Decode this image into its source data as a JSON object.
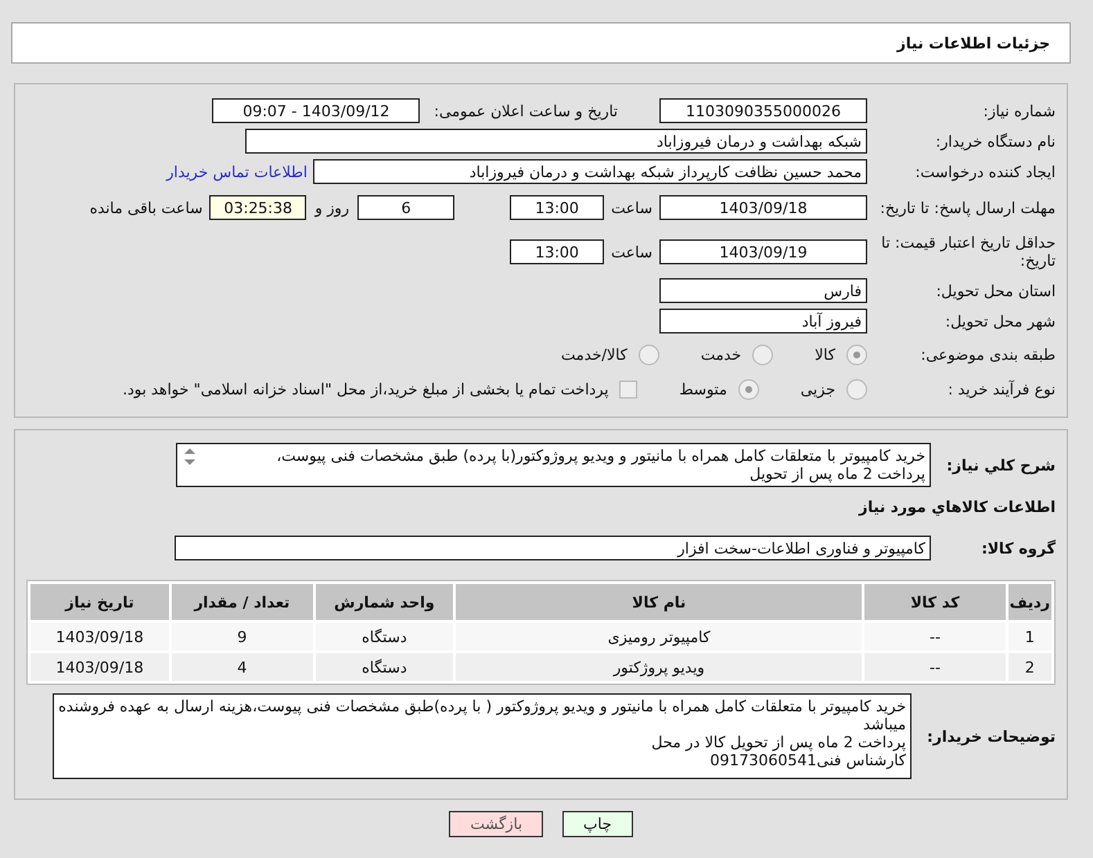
{
  "title": "جزئیات اطلاعات نیاز",
  "need_number": {
    "label": "شماره نیاز:",
    "value": "1103090355000026"
  },
  "announce": {
    "label": "تاریخ و ساعت اعلان عمومی:",
    "value": "1403/09/12 - 09:07"
  },
  "buyer_org": {
    "label": "نام دستگاه خریدار:",
    "value": "شبکه بهداشت و درمان فیروزاباد"
  },
  "requester": {
    "label": "ایجاد کننده درخواست:",
    "value": "محمد حسین نظافت کارپرداز شبکه بهداشت و درمان فیروزاباد",
    "link": "اطلاعات تماس خریدار"
  },
  "deadline": {
    "label": "مهلت ارسال پاسخ: تا تاریخ:",
    "date": "1403/09/18",
    "time_label": "ساعت",
    "time": "13:00",
    "days": "6",
    "days_label": "روز و",
    "remaining": "03:25:38",
    "remaining_label": "ساعت باقی مانده"
  },
  "price_validity": {
    "label": "حداقل تاریخ اعتبار قیمت: تا تاریخ:",
    "date": "1403/09/19",
    "time_label": "ساعت",
    "time": "13:00"
  },
  "province": {
    "label": "استان محل تحویل:",
    "value": "فارس"
  },
  "city": {
    "label": "شهر محل تحویل:",
    "value": "فیروز آباد"
  },
  "category": {
    "label": "طبقه بندی موضوعی:",
    "options": [
      {
        "label": "کالا",
        "selected": true
      },
      {
        "label": "خدمت",
        "selected": false
      },
      {
        "label": "کالا/خدمت",
        "selected": false
      }
    ]
  },
  "process": {
    "label": "نوع فرآیند خرید :",
    "options": [
      {
        "label": "جزیی",
        "selected": false
      },
      {
        "label": "متوسط",
        "selected": true
      }
    ],
    "treasury": {
      "label": "پرداخت تمام یا بخشی از مبلغ خرید،از محل \"اسناد خزانه اسلامی\" خواهد بود.",
      "checked": false
    }
  },
  "summary": {
    "label": "شرح کلي نياز:",
    "lines": [
      "خرید کامپیوتر با متعلقات کامل همراه با مانیتور و ویدیو پروژوکتور(با پرده) طبق مشخصات فنی پیوست،",
      "پرداخت 2 ماه پس از تحویل"
    ]
  },
  "goods_heading": "اطلاعات کالاهاي مورد نياز",
  "goods_group": {
    "label": "گروه کالا:",
    "value": "کامپیوتر و فناوری اطلاعات-سخت افزار"
  },
  "table": {
    "columns": [
      "ردیف",
      "کد کالا",
      "نام کالا",
      "واحد شمارش",
      "تعداد / مقدار",
      "تاریخ نیاز"
    ],
    "rows": [
      [
        "1",
        "--",
        "کامپیوتر رومیزی",
        "دستگاه",
        "9",
        "1403/09/18"
      ],
      [
        "2",
        "--",
        "ویدیو پروژکتور",
        "دستگاه",
        "4",
        "1403/09/18"
      ]
    ]
  },
  "buyer_notes": {
    "label": "توضیحات خریدار:",
    "lines": [
      "خرید کامپیوتر با متعلقات کامل همراه با مانیتور و ویدیو پروژوکتور ( با پرده)طبق مشخصات فنی پیوست،هزینه  ارسال به عهده فروشنده میباشد",
      "پرداخت 2 ماه پس از تحویل کالا در محل",
      "کارشناس فنی09173060541"
    ]
  },
  "buttons": [
    {
      "label": "چاپ",
      "kind": "print"
    },
    {
      "label": "بازگشت",
      "kind": "back"
    }
  ]
}
